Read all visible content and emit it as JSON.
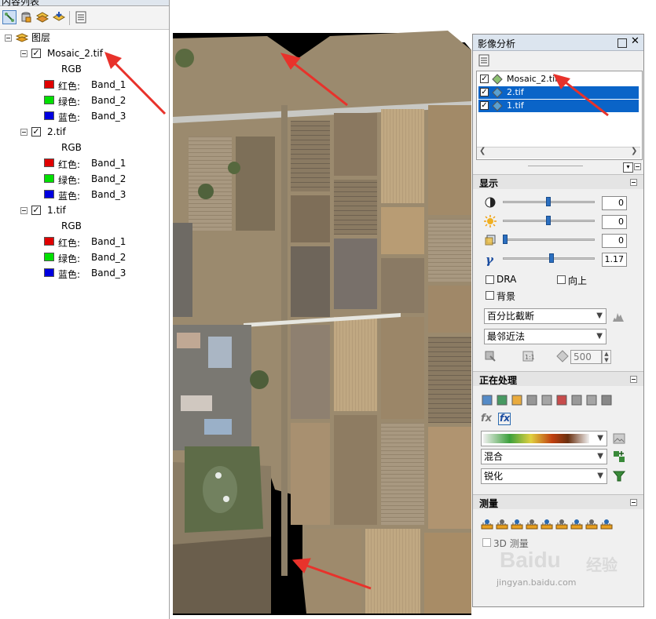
{
  "toc": {
    "title": "内容列表",
    "root_label": "图层",
    "layers": [
      {
        "name": "Mosaic_2.tif",
        "checked": true,
        "composite": "RGB",
        "bands": [
          {
            "channel": "红色:",
            "band": "Band_1",
            "color": "#e00000"
          },
          {
            "channel": "绿色:",
            "band": "Band_2",
            "color": "#00e000"
          },
          {
            "channel": "蓝色:",
            "band": "Band_3",
            "color": "#0000e0"
          }
        ]
      },
      {
        "name": "2.tif",
        "checked": true,
        "composite": "RGB",
        "bands": [
          {
            "channel": "红色:",
            "band": "Band_1",
            "color": "#e00000"
          },
          {
            "channel": "绿色:",
            "band": "Band_2",
            "color": "#00e000"
          },
          {
            "channel": "蓝色:",
            "band": "Band_3",
            "color": "#0000e0"
          }
        ]
      },
      {
        "name": "1.tif",
        "checked": true,
        "composite": "RGB",
        "bands": [
          {
            "channel": "红色:",
            "band": "Band_1",
            "color": "#e00000"
          },
          {
            "channel": "绿色:",
            "band": "Band_2",
            "color": "#00e000"
          },
          {
            "channel": "蓝色:",
            "band": "Band_3",
            "color": "#0000e0"
          }
        ]
      }
    ]
  },
  "panel": {
    "title": "影像分析",
    "layers": [
      {
        "name": "Mosaic_2.tif",
        "checked": true,
        "selected": false
      },
      {
        "name": "2.tif",
        "checked": true,
        "selected": true
      },
      {
        "name": "1.tif",
        "checked": true,
        "selected": true
      }
    ],
    "display": {
      "title": "显示",
      "contrast": "0",
      "brightness": "0",
      "transparency": "0",
      "gamma": "1.17",
      "dra_label": "DRA",
      "north_up_label": "向上",
      "background_label": "背景",
      "stretch": "百分比截断",
      "resampling": "最邻近法",
      "scale_value": "500"
    },
    "processing": {
      "title": "正在处理",
      "blend": "混合",
      "sharpen": "锐化"
    },
    "measure": {
      "title": "测量",
      "measure_3d_label": "3D 测量"
    }
  },
  "watermark": {
    "brand": "Baidu",
    "brand_cn": "经验",
    "url": "jingyan.baidu.com"
  },
  "colors": {
    "selection": "#0a64c8",
    "arrow": "#e8322b",
    "panel_header": "#dce5ef"
  }
}
